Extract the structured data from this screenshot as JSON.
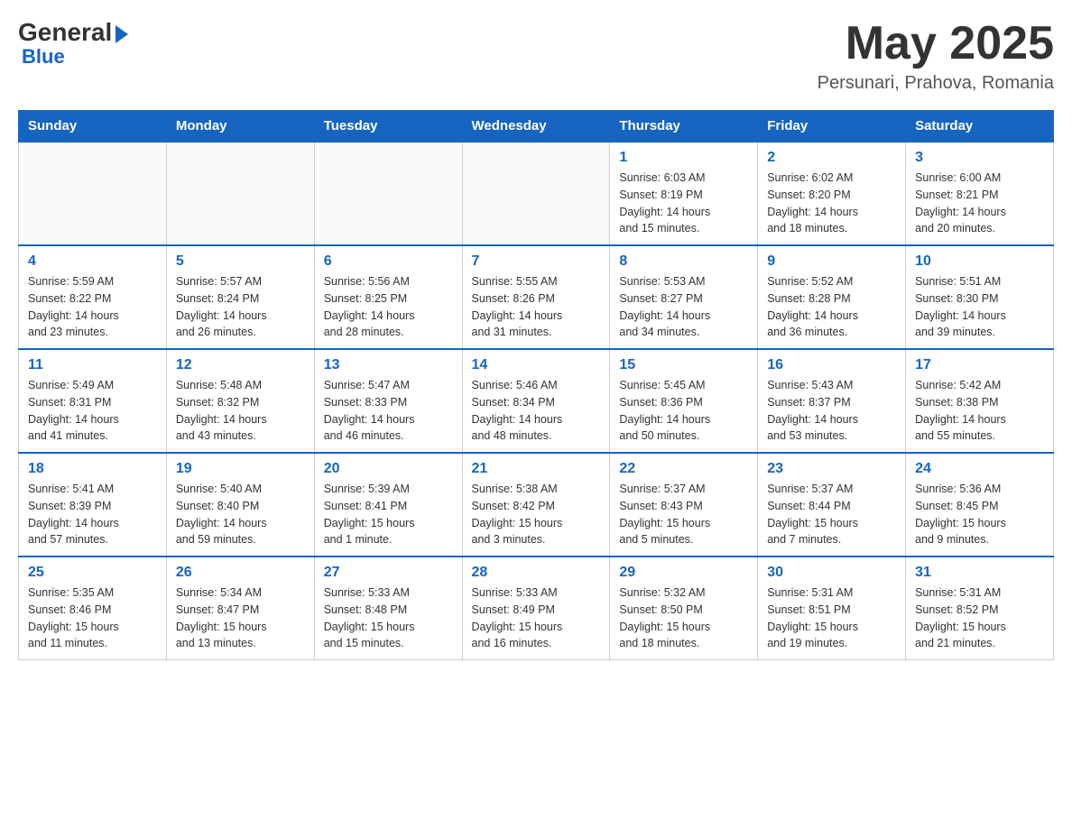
{
  "logo": {
    "general": "General",
    "blue": "Blue"
  },
  "title": "May 2025",
  "location": "Persunari, Prahova, Romania",
  "days_of_week": [
    "Sunday",
    "Monday",
    "Tuesday",
    "Wednesday",
    "Thursday",
    "Friday",
    "Saturday"
  ],
  "weeks": [
    [
      {
        "day": "",
        "info": ""
      },
      {
        "day": "",
        "info": ""
      },
      {
        "day": "",
        "info": ""
      },
      {
        "day": "",
        "info": ""
      },
      {
        "day": "1",
        "info": "Sunrise: 6:03 AM\nSunset: 8:19 PM\nDaylight: 14 hours\nand 15 minutes."
      },
      {
        "day": "2",
        "info": "Sunrise: 6:02 AM\nSunset: 8:20 PM\nDaylight: 14 hours\nand 18 minutes."
      },
      {
        "day": "3",
        "info": "Sunrise: 6:00 AM\nSunset: 8:21 PM\nDaylight: 14 hours\nand 20 minutes."
      }
    ],
    [
      {
        "day": "4",
        "info": "Sunrise: 5:59 AM\nSunset: 8:22 PM\nDaylight: 14 hours\nand 23 minutes."
      },
      {
        "day": "5",
        "info": "Sunrise: 5:57 AM\nSunset: 8:24 PM\nDaylight: 14 hours\nand 26 minutes."
      },
      {
        "day": "6",
        "info": "Sunrise: 5:56 AM\nSunset: 8:25 PM\nDaylight: 14 hours\nand 28 minutes."
      },
      {
        "day": "7",
        "info": "Sunrise: 5:55 AM\nSunset: 8:26 PM\nDaylight: 14 hours\nand 31 minutes."
      },
      {
        "day": "8",
        "info": "Sunrise: 5:53 AM\nSunset: 8:27 PM\nDaylight: 14 hours\nand 34 minutes."
      },
      {
        "day": "9",
        "info": "Sunrise: 5:52 AM\nSunset: 8:28 PM\nDaylight: 14 hours\nand 36 minutes."
      },
      {
        "day": "10",
        "info": "Sunrise: 5:51 AM\nSunset: 8:30 PM\nDaylight: 14 hours\nand 39 minutes."
      }
    ],
    [
      {
        "day": "11",
        "info": "Sunrise: 5:49 AM\nSunset: 8:31 PM\nDaylight: 14 hours\nand 41 minutes."
      },
      {
        "day": "12",
        "info": "Sunrise: 5:48 AM\nSunset: 8:32 PM\nDaylight: 14 hours\nand 43 minutes."
      },
      {
        "day": "13",
        "info": "Sunrise: 5:47 AM\nSunset: 8:33 PM\nDaylight: 14 hours\nand 46 minutes."
      },
      {
        "day": "14",
        "info": "Sunrise: 5:46 AM\nSunset: 8:34 PM\nDaylight: 14 hours\nand 48 minutes."
      },
      {
        "day": "15",
        "info": "Sunrise: 5:45 AM\nSunset: 8:36 PM\nDaylight: 14 hours\nand 50 minutes."
      },
      {
        "day": "16",
        "info": "Sunrise: 5:43 AM\nSunset: 8:37 PM\nDaylight: 14 hours\nand 53 minutes."
      },
      {
        "day": "17",
        "info": "Sunrise: 5:42 AM\nSunset: 8:38 PM\nDaylight: 14 hours\nand 55 minutes."
      }
    ],
    [
      {
        "day": "18",
        "info": "Sunrise: 5:41 AM\nSunset: 8:39 PM\nDaylight: 14 hours\nand 57 minutes."
      },
      {
        "day": "19",
        "info": "Sunrise: 5:40 AM\nSunset: 8:40 PM\nDaylight: 14 hours\nand 59 minutes."
      },
      {
        "day": "20",
        "info": "Sunrise: 5:39 AM\nSunset: 8:41 PM\nDaylight: 15 hours\nand 1 minute."
      },
      {
        "day": "21",
        "info": "Sunrise: 5:38 AM\nSunset: 8:42 PM\nDaylight: 15 hours\nand 3 minutes."
      },
      {
        "day": "22",
        "info": "Sunrise: 5:37 AM\nSunset: 8:43 PM\nDaylight: 15 hours\nand 5 minutes."
      },
      {
        "day": "23",
        "info": "Sunrise: 5:37 AM\nSunset: 8:44 PM\nDaylight: 15 hours\nand 7 minutes."
      },
      {
        "day": "24",
        "info": "Sunrise: 5:36 AM\nSunset: 8:45 PM\nDaylight: 15 hours\nand 9 minutes."
      }
    ],
    [
      {
        "day": "25",
        "info": "Sunrise: 5:35 AM\nSunset: 8:46 PM\nDaylight: 15 hours\nand 11 minutes."
      },
      {
        "day": "26",
        "info": "Sunrise: 5:34 AM\nSunset: 8:47 PM\nDaylight: 15 hours\nand 13 minutes."
      },
      {
        "day": "27",
        "info": "Sunrise: 5:33 AM\nSunset: 8:48 PM\nDaylight: 15 hours\nand 15 minutes."
      },
      {
        "day": "28",
        "info": "Sunrise: 5:33 AM\nSunset: 8:49 PM\nDaylight: 15 hours\nand 16 minutes."
      },
      {
        "day": "29",
        "info": "Sunrise: 5:32 AM\nSunset: 8:50 PM\nDaylight: 15 hours\nand 18 minutes."
      },
      {
        "day": "30",
        "info": "Sunrise: 5:31 AM\nSunset: 8:51 PM\nDaylight: 15 hours\nand 19 minutes."
      },
      {
        "day": "31",
        "info": "Sunrise: 5:31 AM\nSunset: 8:52 PM\nDaylight: 15 hours\nand 21 minutes."
      }
    ]
  ]
}
